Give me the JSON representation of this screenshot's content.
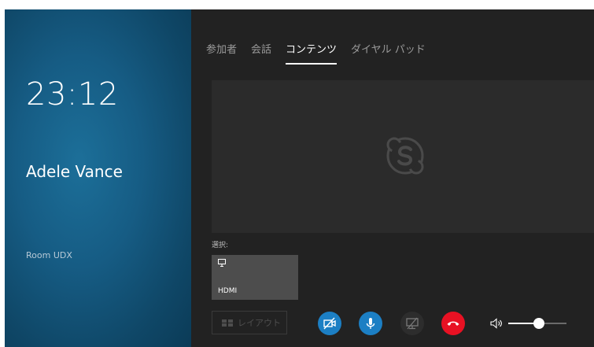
{
  "sidebar": {
    "time": "23:12",
    "user_name": "Adele Vance",
    "room": "Room UDX"
  },
  "tabs": [
    {
      "label": "参加者",
      "active": false
    },
    {
      "label": "会話",
      "active": false
    },
    {
      "label": "コンテンツ",
      "active": true
    },
    {
      "label": "ダイヤル パッド",
      "active": false
    }
  ],
  "content": {
    "select_label": "選択:",
    "source_tile_label": "HDMI",
    "layout_button_label": "レイアウト"
  },
  "controls": {
    "icons": [
      "camera-off-icon",
      "microphone-icon",
      "share-screen-off-icon",
      "hang-up-icon",
      "volume-icon"
    ],
    "volume_level": 0.45
  },
  "colors": {
    "accent_blue": "#1c7fc4",
    "hangup_red": "#e81123",
    "sidebar_blue": "#165c84",
    "background": "#222222"
  }
}
